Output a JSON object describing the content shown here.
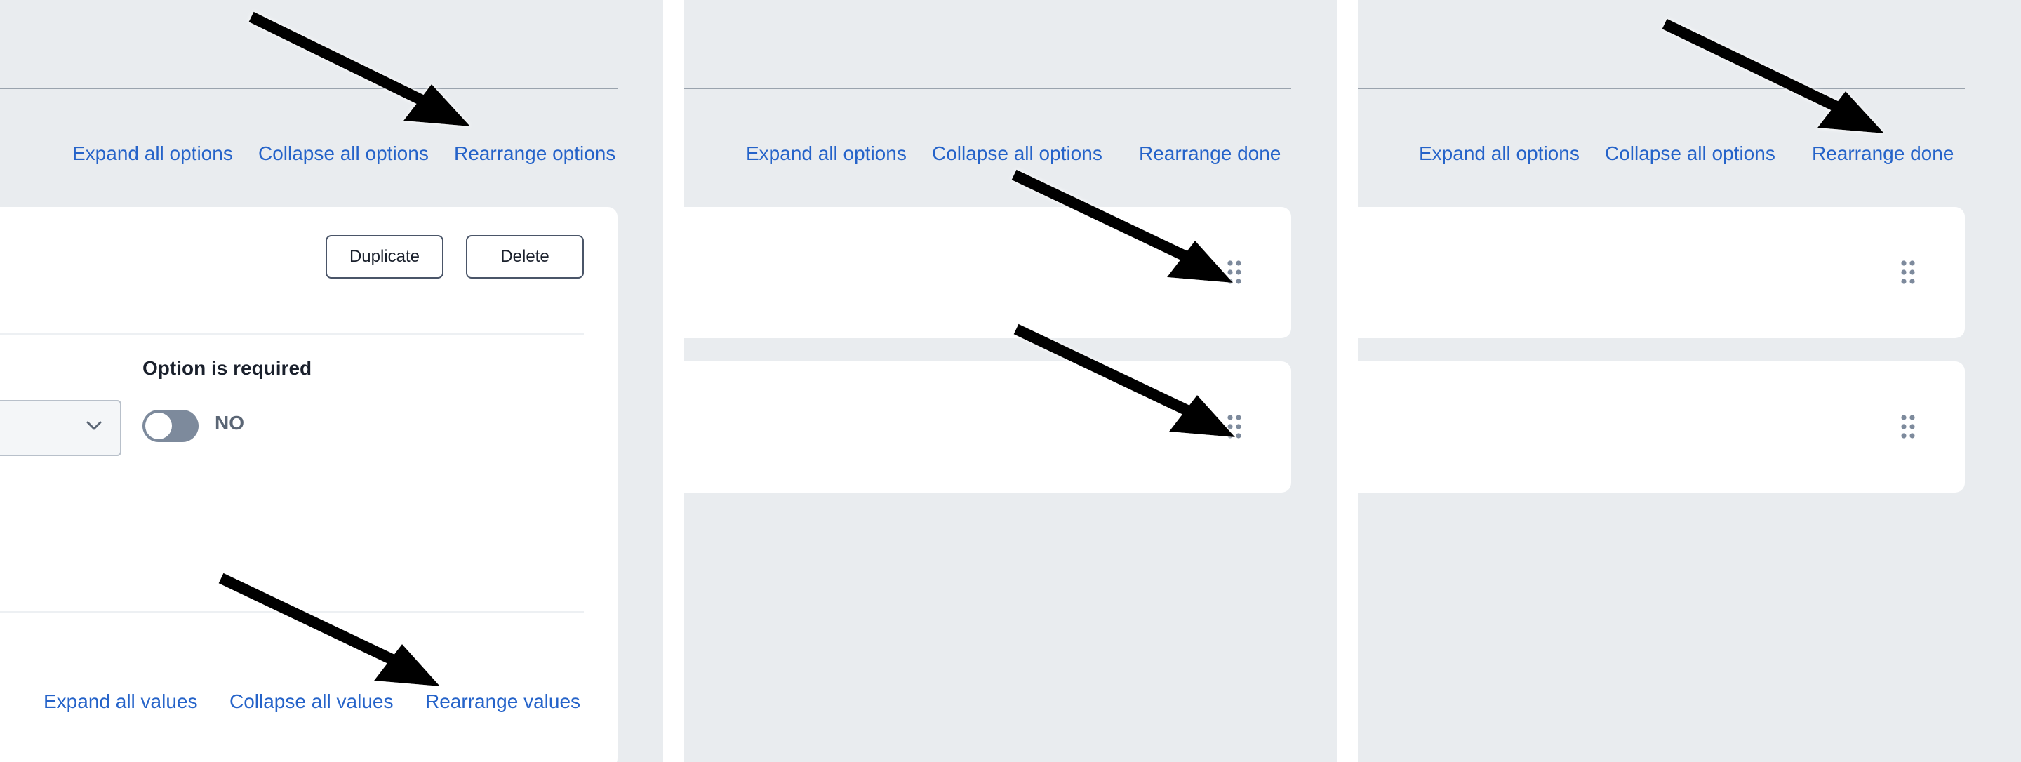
{
  "panel_1": {
    "options_links": {
      "expand": "Expand all options",
      "collapse": "Collapse all options",
      "rearrange": "Rearrange options"
    },
    "card": {
      "duplicate_label": "Duplicate",
      "delete_label": "Delete",
      "required_label": "Option is required",
      "toggle_state": "NO",
      "values_links": {
        "expand": "Expand all values",
        "collapse": "Collapse all values",
        "rearrange": "Rearrange values"
      }
    }
  },
  "panel_2": {
    "options_links": {
      "expand": "Expand all options",
      "collapse": "Collapse all options",
      "rearrange": "Rearrange done"
    }
  },
  "panel_3": {
    "options_links": {
      "expand": "Expand all options",
      "collapse": "Collapse all options",
      "rearrange": "Rearrange done"
    }
  },
  "icons": {
    "drag_handle": "drag-handle-icon",
    "chevron": "chevron-down-icon",
    "annotation_arrow": "annotation-arrow"
  },
  "colors": {
    "background": "#e9ecef",
    "link": "#2563c9",
    "card": "#ffffff",
    "toggle_off": "#7d8a9c",
    "grip": "#7d8a9c",
    "arrow": "#000000"
  }
}
